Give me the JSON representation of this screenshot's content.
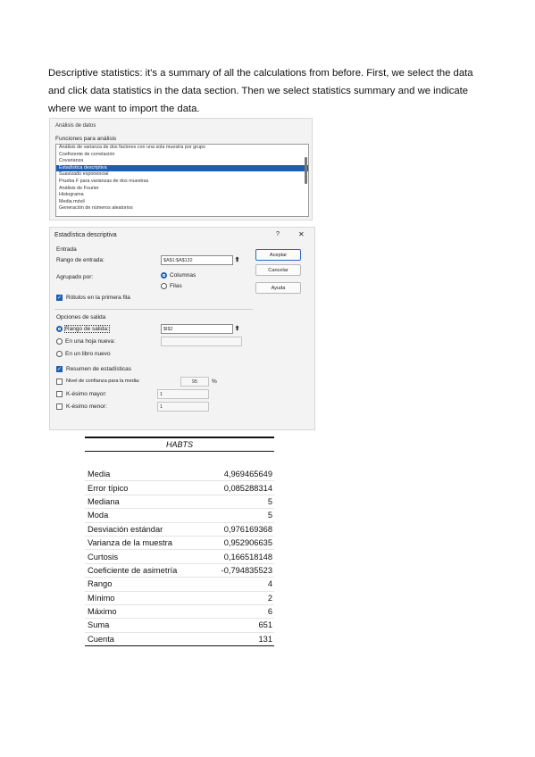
{
  "paragraph": "Descriptive statistics: it's a summary of all the calculations from before. First, we select the data and click data statistics in the data section. Then we select statistics summary and we indicate where we want to import the data.",
  "analysis_dialog": {
    "title": "Análisis de datos",
    "list_label": "Funciones para análisis",
    "items": [
      "Análisis de varianza de dos factores con una sola muestra por grupo",
      "Coeficiente de correlación",
      "Covarianza",
      "Estadística descriptiva",
      "Suavizado exponencial",
      "Prueba F para varianzas de dos muestras",
      "Análisis de Fourier",
      "Histograma",
      "Media móvil",
      "Generación de números aleatorios"
    ],
    "selected_index": 3
  },
  "stats_dialog": {
    "title": "Estadística descriptiva",
    "help": "?",
    "close": "✕",
    "entrada_label": "Entrada",
    "rango_entrada_label": "Rango de entrada:",
    "rango_entrada_value": "$A$1:$A$132",
    "agrupado_label": "Agrupado por:",
    "columnas_label": "Columnas",
    "filas_label": "Filas",
    "rotulos_label": "Rótulos en la primera fila",
    "opciones_label": "Opciones de salida",
    "rango_salida_label": "Rango de salida:",
    "rango_salida_value": "$I$2",
    "hoja_nueva_label": "En una hoja nueva:",
    "libro_nuevo_label": "En un libro nuevo",
    "resumen_label": "Resumen de estadísticas",
    "nivel_confianza_label": "Nivel de confianza para la media:",
    "nivel_confianza_value": "95",
    "nivel_confianza_unit": "%",
    "k_mayor_label": "K-ésimo mayor:",
    "k_mayor_value": "1",
    "k_menor_label": "K-ésimo menor:",
    "k_menor_value": "1",
    "aceptar_label": "Aceptar",
    "cancelar_label": "Cancelar",
    "ayuda_label": "Ayuda"
  },
  "stats_table": {
    "header": "HABTS",
    "rows": [
      {
        "label": "Media",
        "value": "4,969465649"
      },
      {
        "label": "Error típico",
        "value": "0,085288314"
      },
      {
        "label": "Mediana",
        "value": "5"
      },
      {
        "label": "Moda",
        "value": "5"
      },
      {
        "label": "Desviación estándar",
        "value": "0,976169368"
      },
      {
        "label": "Varianza de la muestra",
        "value": "0,952906635"
      },
      {
        "label": "Curtosis",
        "value": "0,166518148"
      },
      {
        "label": "Coeficiente de asimetría",
        "value": "-0,794835523"
      },
      {
        "label": "Rango",
        "value": "4"
      },
      {
        "label": "Mínimo",
        "value": "2"
      },
      {
        "label": "Máximo",
        "value": "6"
      },
      {
        "label": "Suma",
        "value": "651"
      },
      {
        "label": "Cuenta",
        "value": "131"
      }
    ]
  }
}
